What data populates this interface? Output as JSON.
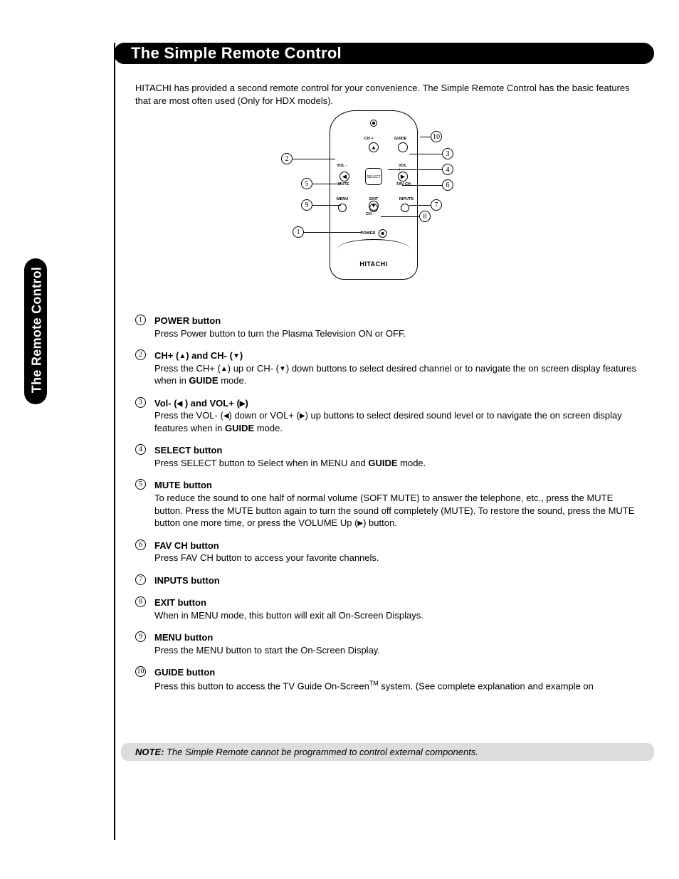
{
  "title": "The Simple Remote Control",
  "sideTab": "The Remote Control",
  "intro": "HITACHI has provided a second remote control for your convenience.  The Simple Remote Control has the basic features that are most often used (Only  for HDX models).",
  "brand": "HITACHI",
  "remoteLabels": {
    "chPlus": "CH +",
    "chMinus": "CH -",
    "volMinus": "VOL -",
    "volPlus": "VOL +",
    "select": "SELECT",
    "guide": "GUIDE",
    "mute": "MUTE",
    "favCh": "FAV CH",
    "menu": "MENU",
    "exit": "EXIT",
    "inputs": "INPUTS",
    "power": "POWER"
  },
  "callouts": [
    "1",
    "2",
    "3",
    "4",
    "5",
    "6",
    "7",
    "8",
    "9",
    "10"
  ],
  "glyph": {
    "up": "▲",
    "down": "▼",
    "left": "◀",
    "right": "▶"
  },
  "items": [
    {
      "num": "1",
      "title": "POWER button",
      "desc": "Press Power button to turn the Plasma Television ON or OFF."
    },
    {
      "num": "2",
      "title_html": "CH+ (<span class='tri'>▲</span>) and CH- (<span class='tri'>▼</span>)",
      "desc_html": "Press the CH+ (<span class='tri'>▲</span>) up or CH- (<span class='tri'>▼</span>) down buttons to select desired channel or to navigate the on screen display features when in <b>GUIDE</b> mode."
    },
    {
      "num": "3",
      "title_html": "Vol- (<span class='tri'>◀</span> ) and VOL+ (<span class='tri'>▶</span>)",
      "desc_html": "Press the VOL- (<span class='tri'>◀</span>) down or VOL+ (<span class='tri'>▶</span>) up buttons to select desired sound level or to navigate the on screen display features when in <b>GUIDE</b> mode."
    },
    {
      "num": "4",
      "title": "SELECT button",
      "desc_html": "Press SELECT button to Select when in MENU and <b>GUIDE</b> mode."
    },
    {
      "num": "5",
      "title": "MUTE button",
      "desc_html": "To reduce the sound to one half of normal volume (SOFT MUTE) to answer the telephone, etc., press the MUTE button.  Press the MUTE button again to turn the sound off completely (MUTE).  To restore the sound, press the MUTE button one more time, or press the VOLUME Up (<span class='tri'>▶</span>) button."
    },
    {
      "num": "6",
      "title": "FAV CH button",
      "desc": "Press FAV CH button to access your favorite channels."
    },
    {
      "num": "7",
      "title": "INPUTS button",
      "desc": ""
    },
    {
      "num": "8",
      "title": "EXIT button",
      "desc": "When in MENU mode, this button will exit all On-Screen Displays."
    },
    {
      "num": "9",
      "title": "MENU button",
      "desc": "Press the MENU button to start the On-Screen Display."
    },
    {
      "num": "10",
      "title": "GUIDE button",
      "desc_html": "Press this button to access the TV Guide On-Screen<sup>TM</sup> system.  (See complete explanation and example on"
    }
  ],
  "note": {
    "label": "NOTE:",
    "text": "  The Simple Remote cannot be programmed to control external components."
  }
}
